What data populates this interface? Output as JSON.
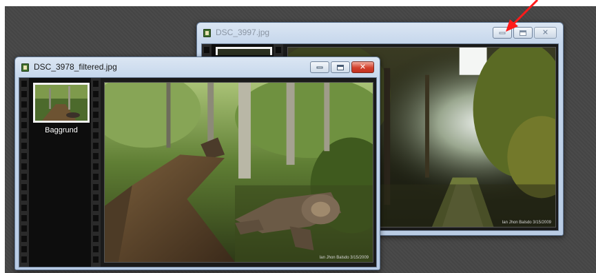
{
  "windows": {
    "back": {
      "title": "DSC_3997.jpg",
      "watermark": "Ian Jhon Balsdo 3/15/2009"
    },
    "front": {
      "title": "DSC_3978_filtered.jpg",
      "layer_label": "Baggrund",
      "watermark": "Ian Jhon Balsdo 3/15/2009"
    }
  },
  "buttons": {
    "minimize": "minimize",
    "maximize": "maximize",
    "close": "✕"
  },
  "annotation": {
    "arrow_color": "#ff1a1a"
  },
  "colors": {
    "desktop": "#4a4a4a",
    "close_active": "#d2402c",
    "frame": "#c6d7ec"
  }
}
